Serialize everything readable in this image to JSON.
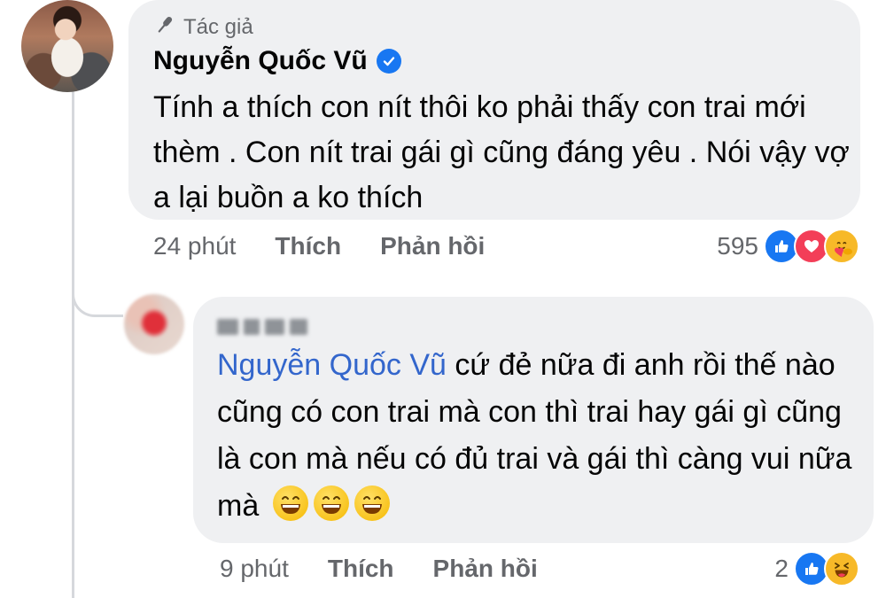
{
  "comment": {
    "author_badge": "Tác giả",
    "author_name": "Nguyễn Quốc Vũ",
    "text": "Tính a thích con nít thôi ko phải thấy con trai mới thèm . Con nít trai gái gì cũng đáng yêu . Nói vậy vợ a lại buồn a ko thích",
    "time": "24 phút",
    "like_label": "Thích",
    "reply_label": "Phản hồi",
    "reaction_count": "595",
    "reactions": [
      "like-icon",
      "love-icon",
      "care-icon"
    ]
  },
  "reply": {
    "mention": "Nguyễn Quốc Vũ",
    "text": " cứ đẻ nữa đi anh rồi thế nào cũng có con trai mà con thì trai hay gái gì cũng là con mà nếu có đủ trai và gái thì càng vui nữa mà",
    "emojis": [
      "grinning-emoji",
      "grinning-emoji",
      "grinning-emoji"
    ],
    "time": "9 phút",
    "like_label": "Thích",
    "reply_label": "Phản hồi",
    "reaction_count": "2",
    "reactions": [
      "like-icon",
      "haha-icon"
    ]
  },
  "colors": {
    "bubble": "#eff0f2",
    "meta_text": "#65676b",
    "mention": "#3366cc",
    "like_blue": "#1877f2",
    "love_red": "#f33e58",
    "emoji_yellow": "#f7b928"
  }
}
